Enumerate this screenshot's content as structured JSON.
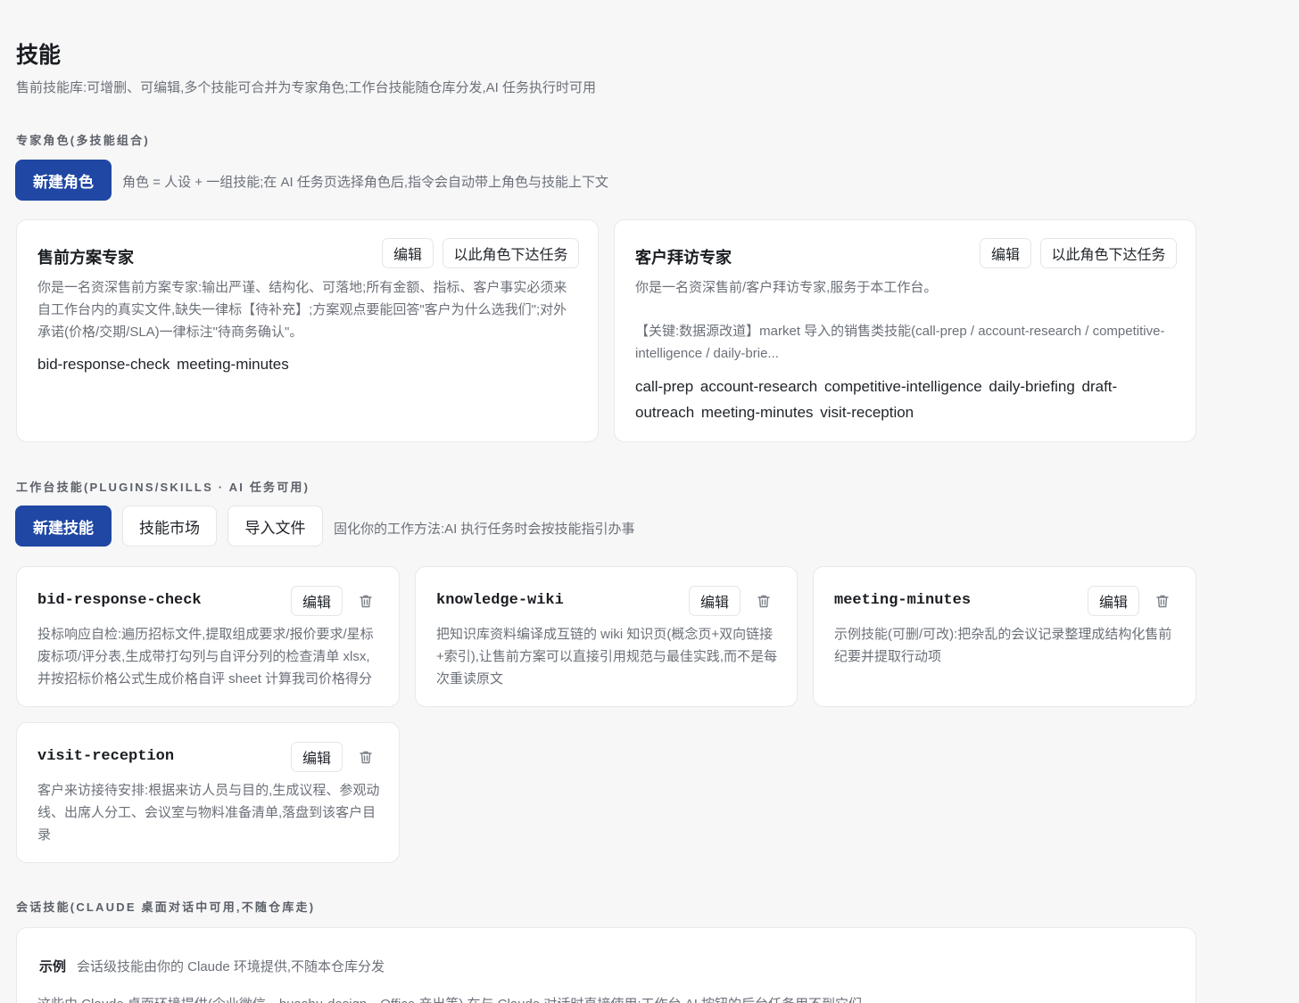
{
  "header": {
    "title": "技能",
    "subtitle": "售前技能库:可增删、可编辑,多个技能可合并为专家角色;工作台技能随仓库分发,AI 任务执行时可用"
  },
  "roles": {
    "section_label": "专家角色(多技能组合)",
    "new_button": "新建角色",
    "hint": "角色 = 人设 + 一组技能;在 AI 任务页选择角色后,指令会自动带上角色与技能上下文",
    "items": [
      {
        "title": "售前方案专家",
        "edit_label": "编辑",
        "assign_label": "以此角色下达任务",
        "desc": "你是一名资深售前方案专家:输出严谨、结构化、可落地;所有金额、指标、客户事实必须来自工作台内的真实文件,缺失一律标【待补充】;方案观点要能回答\"客户为什么选我们\";对外承诺(价格/交期/SLA)一律标注\"待商务确认\"。",
        "skills": "bid-response-check  meeting-minutes"
      },
      {
        "title": "客户拜访专家",
        "edit_label": "编辑",
        "assign_label": "以此角色下达任务",
        "desc": "你是一名资深售前/客户拜访专家,服务于本工作台。",
        "desc2": "【关键:数据源改道】market 导入的销售类技能(call-prep / account-research / competitive-intelligence / daily-brie...",
        "skills": "call-prep  account-research  competitive-intelligence  daily-briefing  draft-outreach  meeting-minutes  visit-reception"
      }
    ]
  },
  "workspace_skills": {
    "section_label": "工作台技能(PLUGINS/SKILLS · AI 任务可用)",
    "new_button": "新建技能",
    "market_button": "技能市场",
    "import_button": "导入文件",
    "hint": "固化你的工作方法:AI 执行任务时会按技能指引办事",
    "items": [
      {
        "name": "bid-response-check",
        "edit_label": "编辑",
        "desc": "投标响应自检:遍历招标文件,提取组成要求/报价要求/星标废标项/评分表,生成带打勾列与自评分列的检查清单 xlsx,并按招标价格公式生成价格自评 sheet 计算我司价格得分"
      },
      {
        "name": "knowledge-wiki",
        "edit_label": "编辑",
        "desc": "把知识库资料编译成互链的 wiki 知识页(概念页+双向链接+索引),让售前方案可以直接引用规范与最佳实践,而不是每次重读原文"
      },
      {
        "name": "meeting-minutes",
        "edit_label": "编辑",
        "desc": "示例技能(可删/可改):把杂乱的会议记录整理成结构化售前纪要并提取行动项"
      },
      {
        "name": "visit-reception",
        "edit_label": "编辑",
        "desc": "客户来访接待安排:根据来访人员与目的,生成议程、参观动线、出席人分工、会议室与物料准备清单,落盘到该客户目录"
      }
    ]
  },
  "session_skills": {
    "section_label": "会话技能(CLAUDE 桌面对话中可用,不随仓库走)",
    "example_label": "示例",
    "example_hint": "会话级技能由你的 Claude 环境提供,不随本仓库分发",
    "more": "这些由 Claude 桌面环境提供(企业微信、huashu-design、Office 产出等),在与 Claude 对话时直接使用;工作台 AI 按钮的后台任务用不到它们"
  },
  "icons": {
    "trash": "trash-icon"
  },
  "colors": {
    "primary": "#1f47a3",
    "background": "#f7f7f8",
    "card_border": "#e8e9ec",
    "muted_text": "#6b7078"
  }
}
